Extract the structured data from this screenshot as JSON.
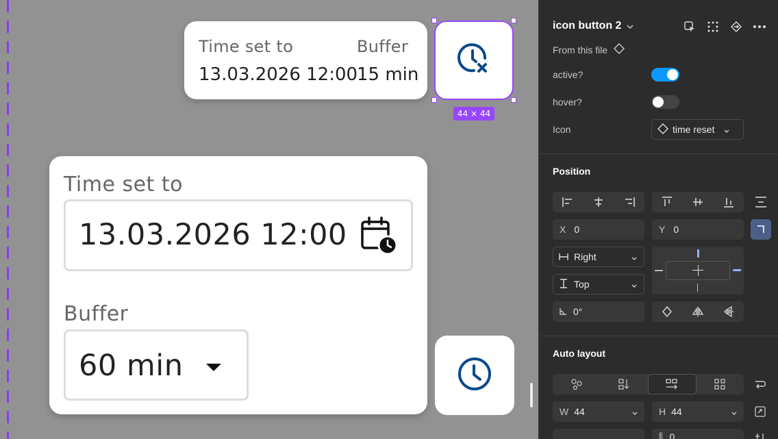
{
  "canvas": {
    "small_card": {
      "time_label": "Time set to",
      "time_value": "13.03.2026 12:00",
      "buffer_label": "Buffer",
      "buffer_value": "15 min"
    },
    "selection_size": "44 × 44",
    "big_card": {
      "time_label": "Time set to",
      "date_value": "13.03.2026 12:00",
      "buffer_label": "Buffer",
      "buffer_value": "60 min"
    }
  },
  "panel": {
    "component_name": "icon button 2",
    "source": "From this file",
    "props": {
      "active_label": "active?",
      "active_on": true,
      "hover_label": "hover?",
      "hover_on": false,
      "icon_label": "Icon",
      "icon_value": "time reset"
    },
    "position": {
      "title": "Position",
      "x_label": "X",
      "x_value": "0",
      "y_label": "Y",
      "y_value": "0",
      "h_constraint": "Right",
      "v_constraint": "Top",
      "rotation": "0°"
    },
    "auto_layout": {
      "title": "Auto layout",
      "w_label": "W",
      "w_value": "44",
      "h_label": "H",
      "h_value": "44",
      "gap_value": "0"
    }
  },
  "colors": {
    "accent": "#9747ff",
    "icon_blue": "#0b4a8b",
    "toggle_on": "#0d99ff",
    "panel_bg": "#2c2c2c",
    "canvas_bg": "#929292"
  }
}
